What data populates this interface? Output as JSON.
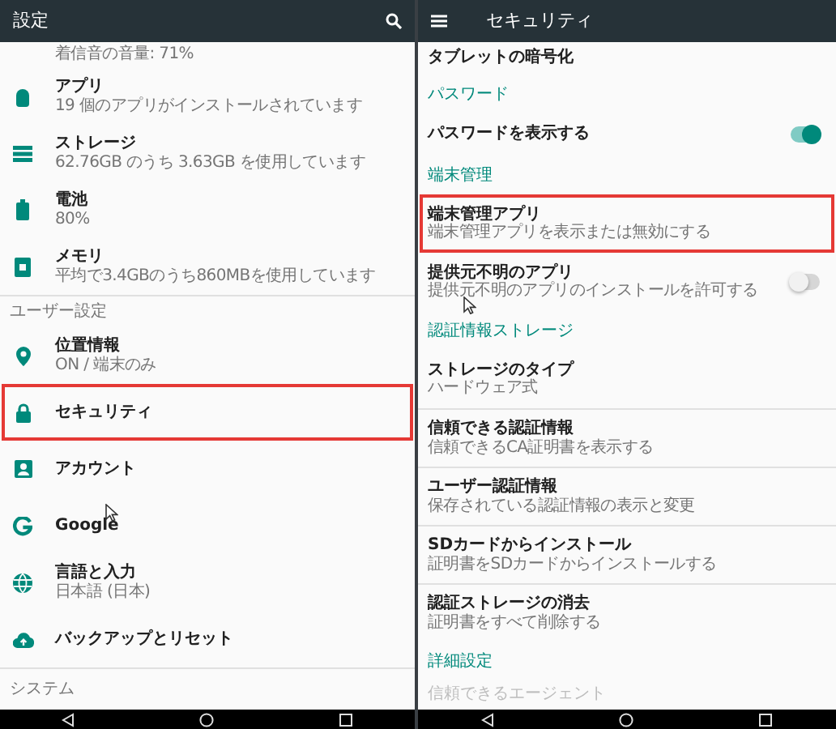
{
  "left": {
    "title": "設定",
    "items": [
      {
        "kind": "setting",
        "subtitle": "着信音の音量: 71%",
        "highlighted": false
      },
      {
        "kind": "setting",
        "title": "アプリ",
        "subtitle": "19 個のアプリがインストールされています",
        "highlighted": false
      },
      {
        "kind": "setting",
        "title": "ストレージ",
        "subtitle": "62.76GB のうち 3.63GB を使用しています",
        "highlighted": false
      },
      {
        "kind": "setting",
        "title": "電池",
        "subtitle": "80%",
        "highlighted": false
      },
      {
        "kind": "setting",
        "title": "メモリ",
        "subtitle": "平均で3.4GBのうち860MBを使用しています",
        "highlighted": false
      },
      {
        "kind": "category",
        "title": "ユーザー設定"
      },
      {
        "kind": "setting",
        "title": "位置情報",
        "subtitle": "ON / 端末のみ",
        "highlighted": false
      },
      {
        "kind": "setting",
        "title": "セキュリティ",
        "highlighted": true
      },
      {
        "kind": "setting",
        "title": "アカウント",
        "highlighted": false
      },
      {
        "kind": "setting",
        "title": "Google",
        "highlighted": false
      },
      {
        "kind": "setting",
        "title": "言語と入力",
        "subtitle": "日本語 (日本)",
        "highlighted": false
      },
      {
        "kind": "setting",
        "title": "バックアップとリセット",
        "highlighted": false
      },
      {
        "kind": "category",
        "title": "システム"
      }
    ]
  },
  "right": {
    "title": "セキュリティ",
    "items": [
      {
        "kind": "setting",
        "title": "タブレットの暗号化",
        "highlighted": false,
        "disabled": false
      },
      {
        "kind": "category",
        "title": "パスワード"
      },
      {
        "kind": "toggle",
        "title": "パスワードを表示する",
        "on": true,
        "highlighted": false,
        "disabled": false
      },
      {
        "kind": "category",
        "title": "端末管理"
      },
      {
        "kind": "setting",
        "title": "端末管理アプリ",
        "subtitle": "端末管理アプリを表示または無効にする",
        "highlighted": true,
        "disabled": false
      },
      {
        "kind": "toggle",
        "title": "提供元不明のアプリ",
        "subtitle": "提供元不明のアプリのインストールを許可する",
        "on": false,
        "highlighted": false,
        "disabled": false
      },
      {
        "kind": "category",
        "title": "認証情報ストレージ"
      },
      {
        "kind": "setting",
        "title": "ストレージのタイプ",
        "subtitle": "ハードウェア式",
        "highlighted": false,
        "disabled": false
      },
      {
        "kind": "setting",
        "title": "信頼できる認証情報",
        "subtitle": "信頼できるCA証明書を表示する",
        "highlighted": false,
        "disabled": false
      },
      {
        "kind": "setting",
        "title": "ユーザー認証情報",
        "subtitle": "保存されている認証情報の表示と変更",
        "highlighted": false,
        "disabled": false
      },
      {
        "kind": "setting",
        "title": "SDカードからインストール",
        "subtitle": "証明書をSDカードからインストールする",
        "highlighted": false,
        "disabled": false
      },
      {
        "kind": "setting",
        "title": "認証ストレージの消去",
        "subtitle": "証明書をすべて削除する",
        "highlighted": false,
        "disabled": false
      },
      {
        "kind": "category",
        "title": "詳細設定"
      },
      {
        "kind": "setting",
        "title": "信頼できるエージェント",
        "highlighted": false,
        "disabled": true
      }
    ]
  }
}
